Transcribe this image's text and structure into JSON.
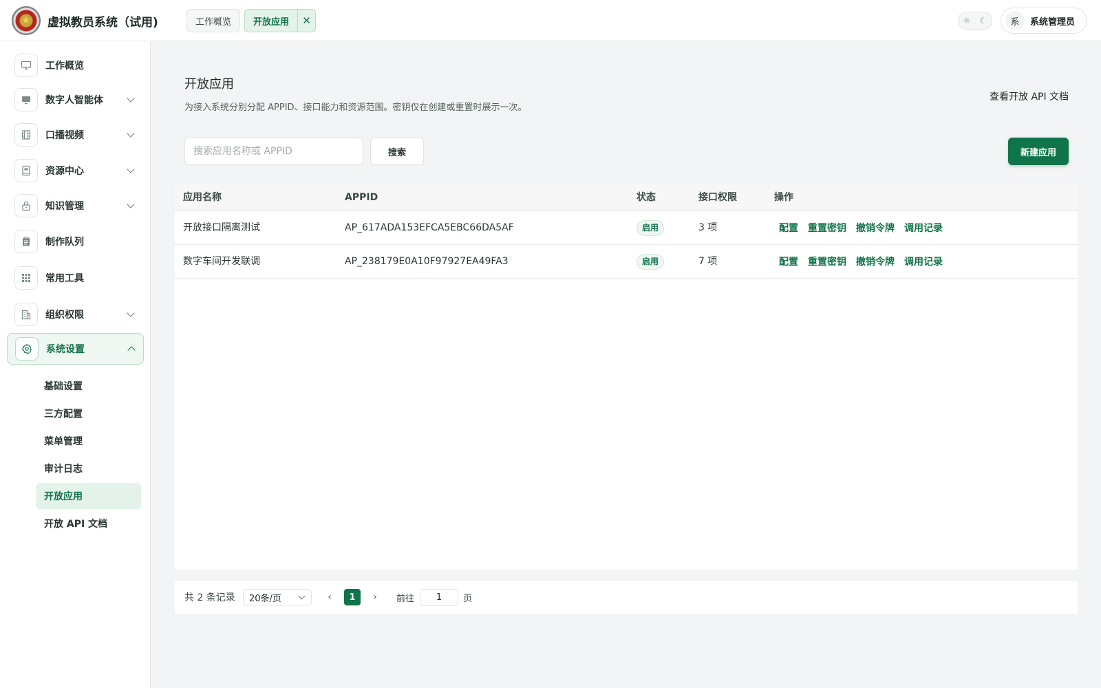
{
  "app": {
    "title": "虚拟教员系统（试用)"
  },
  "tabs": [
    {
      "label": "工作概览",
      "active": false
    },
    {
      "label": "开放应用",
      "active": true,
      "close_icon": "close-icon"
    }
  ],
  "header": {
    "theme_icons": [
      "sun-icon",
      "moon-icon"
    ],
    "user": {
      "avatar_text": "系",
      "name": "系统管理员"
    }
  },
  "sidebar": {
    "items": [
      {
        "label": "工作概览",
        "icon": "monitor-icon",
        "has_chevron": false
      },
      {
        "label": "数字人智能体",
        "icon": "screen-icon",
        "has_chevron": true
      },
      {
        "label": "口播视频",
        "icon": "film-icon",
        "has_chevron": true
      },
      {
        "label": "资源中心",
        "icon": "book-icon",
        "has_chevron": true
      },
      {
        "label": "知识管理",
        "icon": "lock-icon",
        "has_chevron": true
      },
      {
        "label": "制作队列",
        "icon": "clipboard-icon",
        "has_chevron": false
      },
      {
        "label": "常用工具",
        "icon": "grid-icon",
        "has_chevron": false
      },
      {
        "label": "组织权限",
        "icon": "building-icon",
        "has_chevron": true
      },
      {
        "label": "系统设置",
        "icon": "gear-icon",
        "has_chevron": true,
        "expanded": true,
        "active": true
      }
    ],
    "sub_items": [
      {
        "label": "基础设置",
        "active": false
      },
      {
        "label": "三方配置",
        "active": false
      },
      {
        "label": "菜单管理",
        "active": false
      },
      {
        "label": "审计日志",
        "active": false
      },
      {
        "label": "开放应用",
        "active": true
      },
      {
        "label": "开放 API 文档",
        "active": false
      }
    ]
  },
  "page": {
    "title": "开放应用",
    "description": "为接入系统分别分配 APPID、接口能力和资源范围。密钥仅在创建或重置时展示一次。",
    "api_doc_link": "查看开放 API 文档",
    "search": {
      "placeholder": "搜索应用名称或 APPID",
      "value": "",
      "button": "搜索"
    },
    "new_button": "新建应用"
  },
  "table": {
    "columns": [
      "应用名称",
      "APPID",
      "状态",
      "接口权限",
      "操作"
    ],
    "rows": [
      {
        "name": "开放接口隔离测试",
        "appid": "AP_617ADA153EFCA5EBC66DA5AF",
        "status": "启用",
        "permissions": "3 项",
        "actions": [
          "配置",
          "重置密钥",
          "撤销令牌",
          "调用记录"
        ]
      },
      {
        "name": "数字车间开发联调",
        "appid": "AP_238179E0A10F97927EA49FA3",
        "status": "启用",
        "permissions": "7 项",
        "actions": [
          "配置",
          "重置密钥",
          "撤销令牌",
          "调用记录"
        ]
      }
    ]
  },
  "pagination": {
    "total": "共 2 条记录",
    "page_size": "20条/页",
    "current_page": "1",
    "goto_label": "前往",
    "goto_value": "1",
    "goto_unit": "页"
  },
  "colors": {
    "accent": "#0f7449",
    "accent_light": "#e3f3ea",
    "badge_bg": "#eef7f1"
  }
}
